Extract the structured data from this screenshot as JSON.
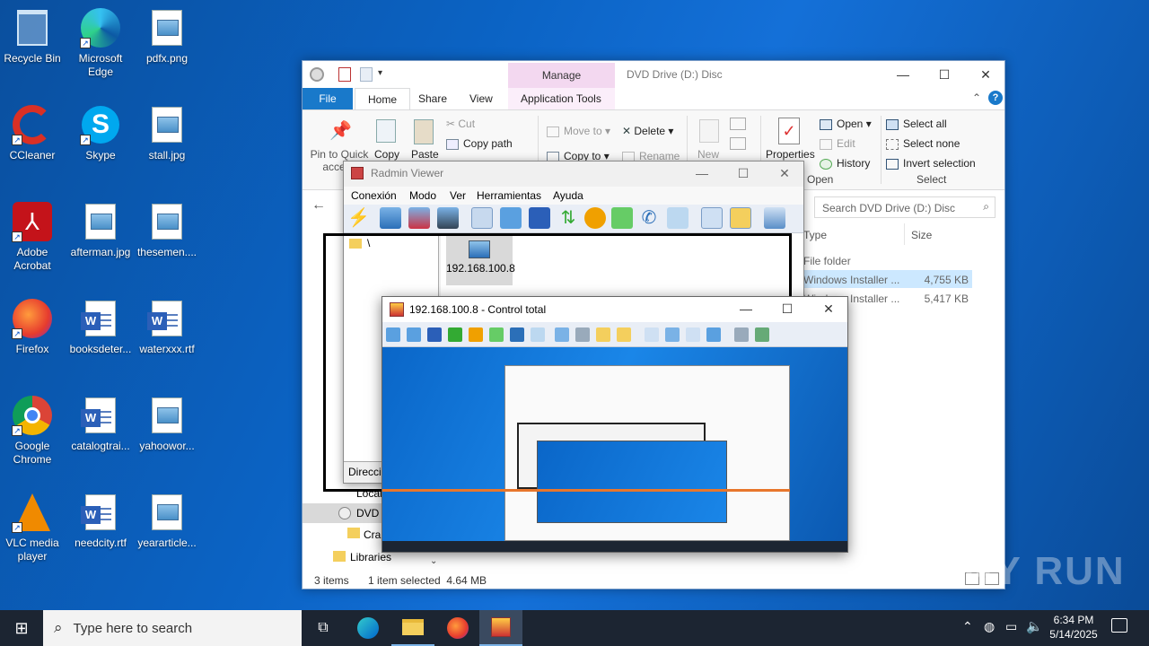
{
  "desktop": {
    "icons": [
      {
        "label": "Recycle Bin",
        "icon": "recycle-bin-icon"
      },
      {
        "label": "Microsoft Edge",
        "icon": "edge-icon"
      },
      {
        "label": "pdfx.png",
        "icon": "image-file-icon"
      },
      {
        "label": "CCleaner",
        "icon": "ccleaner-icon"
      },
      {
        "label": "Skype",
        "icon": "skype-icon"
      },
      {
        "label": "stall.jpg",
        "icon": "image-file-icon"
      },
      {
        "label": "Adobe Acrobat",
        "icon": "acrobat-icon"
      },
      {
        "label": "afterman.jpg",
        "icon": "image-file-icon"
      },
      {
        "label": "thesemen....",
        "icon": "image-file-icon"
      },
      {
        "label": "Firefox",
        "icon": "firefox-icon"
      },
      {
        "label": "booksdeter...",
        "icon": "word-doc-icon"
      },
      {
        "label": "waterxxx.rtf",
        "icon": "word-doc-icon"
      },
      {
        "label": "Google Chrome",
        "icon": "chrome-icon"
      },
      {
        "label": "catalogtrai...",
        "icon": "word-doc-icon"
      },
      {
        "label": "yahoowor...",
        "icon": "image-file-icon"
      },
      {
        "label": "VLC media player",
        "icon": "vlc-icon"
      },
      {
        "label": "needcity.rtf",
        "icon": "word-doc-icon"
      },
      {
        "label": "yeararticle...",
        "icon": "image-file-icon"
      }
    ]
  },
  "explorer": {
    "title": "DVD Drive (D:) Disc",
    "context_tab_group": "Manage",
    "tabs": [
      "File",
      "Home",
      "Share",
      "View",
      "Application Tools"
    ],
    "clipboard": {
      "pin": "Pin to Quick access",
      "copy": "Copy",
      "paste": "Paste",
      "cut": "Cut",
      "copy_path": "Copy path"
    },
    "organize": {
      "move_to": "Move to",
      "copy_to": "Copy to",
      "delete": "Delete",
      "rename": "Rename"
    },
    "new": {
      "new": "New"
    },
    "open": {
      "properties": "Properties",
      "open": "Open",
      "edit": "Edit",
      "history": "History",
      "label": "Open"
    },
    "select": {
      "all": "Select all",
      "none": "Select none",
      "invert": "Invert selection",
      "label": "Select"
    },
    "search_placeholder": "Search DVD Drive (D:) Disc",
    "columns": {
      "type": "Type",
      "size": "Size"
    },
    "rows": [
      {
        "type": "File folder",
        "size": ""
      },
      {
        "type": "Windows Installer ...",
        "size": "4,755 KB"
      },
      {
        "type": "Windows Installer ...",
        "size": "5,417 KB"
      }
    ],
    "nav": [
      "Local",
      "DVD",
      "Cra",
      "Libraries"
    ],
    "status": {
      "items": "3 items",
      "selected": "1 item selected  4.64 MB"
    }
  },
  "radmin": {
    "title": "Radmin Viewer",
    "menu": [
      "Conexión",
      "Modo",
      "Ver",
      "Herramientas",
      "Ayuda"
    ],
    "tree_root": "\\",
    "host": "192.168.100.8",
    "address_label": "Direcci"
  },
  "control": {
    "title": "192.168.100.8 - Control total"
  },
  "taskbar": {
    "search_placeholder": "Type here to search",
    "time": "6:34 PM",
    "date": "5/14/2025"
  },
  "watermark": "ANY RUN"
}
